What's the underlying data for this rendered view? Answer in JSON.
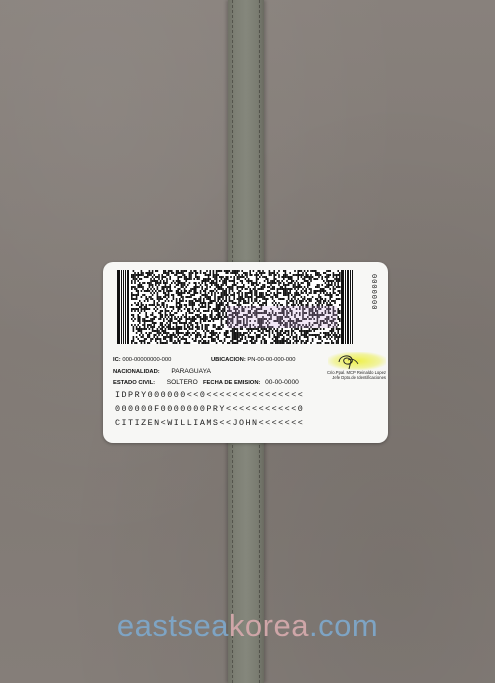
{
  "card": {
    "serial": "0000000",
    "ic": {
      "label": "IC:",
      "value": "000-00000000-000"
    },
    "ubicacion": {
      "label": "UBICACION:",
      "value": "PN-00-00-000-000"
    },
    "nacionalidad": {
      "label": "NACIONALIDAD:",
      "value": "PARAGUAYA"
    },
    "estado_civil": {
      "label": "ESTADO CIVIL:",
      "value": "SOLTERO"
    },
    "fecha_emision": {
      "label": "FECHA DE EMISION:",
      "value": "00-00-0000"
    },
    "signer_line1": "Crio.Ppal. MCP Reinaldo Lopez",
    "signer_line2": "Jefe Dpto.de Identificaciones",
    "mrz": [
      "IDPRY000000<<0<<<<<<<<<<<<<<<",
      "000000F0000000PRY<<<<<<<<<<<0",
      "CITIZEN<WILLIAMS<<JOHN<<<<<<<"
    ]
  },
  "watermark": {
    "part1": "eastsea",
    "part2": "korea",
    "part3": ".com"
  },
  "colors": {
    "background": "#847d79",
    "strap": "#7d7f74",
    "card": "#f7f7f5",
    "watermark_blue": "#7ea4c4",
    "watermark_pink": "#cfa6a8"
  }
}
